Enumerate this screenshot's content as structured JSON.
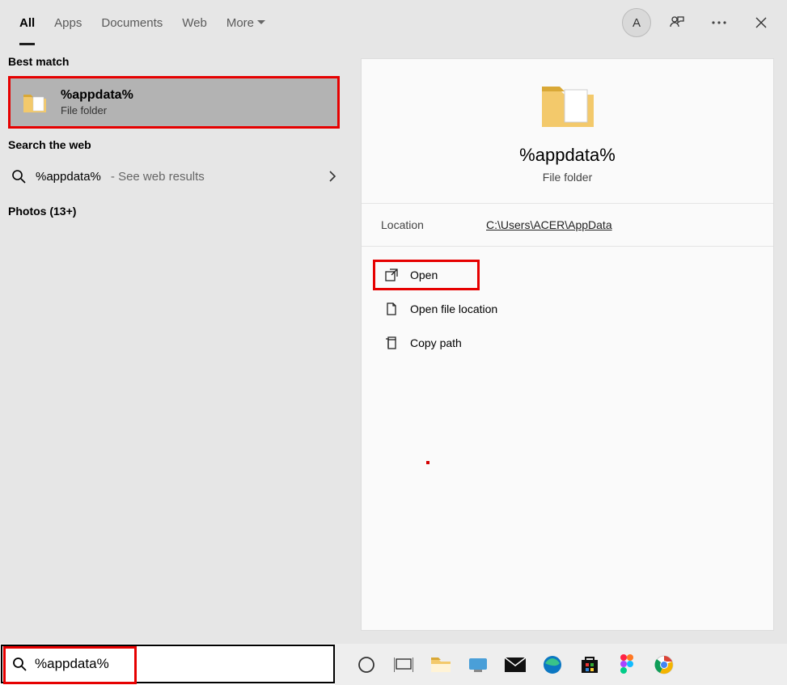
{
  "tabs": {
    "all": "All",
    "apps": "Apps",
    "documents": "Documents",
    "web": "Web",
    "more": "More"
  },
  "avatar_initial": "A",
  "sections": {
    "best_match": "Best match",
    "search_web": "Search the web",
    "photos": "Photos (13+)"
  },
  "best_match": {
    "title": "%appdata%",
    "subtitle": "File folder"
  },
  "web_result": {
    "term": "%appdata%",
    "suffix": " - See web results"
  },
  "detail": {
    "title": "%appdata%",
    "subtitle": "File folder",
    "location_label": "Location",
    "location_value": "C:\\Users\\ACER\\AppData"
  },
  "actions": {
    "open": "Open",
    "open_location": "Open file location",
    "copy_path": "Copy path"
  },
  "search_value": "%appdata%"
}
